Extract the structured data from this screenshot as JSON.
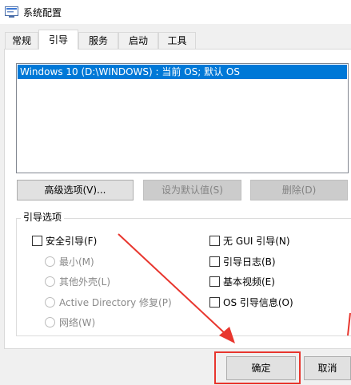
{
  "window": {
    "title": "系统配置",
    "icon": "msconfig-icon"
  },
  "tabs": [
    {
      "label": "常规"
    },
    {
      "label": "引导"
    },
    {
      "label": "服务"
    },
    {
      "label": "启动"
    },
    {
      "label": "工具"
    }
  ],
  "boot_list": {
    "entries": [
      "Windows 10 (D:\\WINDOWS) : 当前 OS; 默认 OS"
    ]
  },
  "buttons": {
    "advanced": "高级选项(V)...",
    "set_default": "设为默认值(S)",
    "delete": "删除(D)",
    "ok": "确定",
    "cancel": "取消"
  },
  "boot_options": {
    "group_label": "引导选项",
    "safe_boot": "安全引导(F)",
    "radios": [
      "最小(M)",
      "其他外壳(L)",
      "Active Directory 修复(P)",
      "网络(W)"
    ],
    "no_gui_boot": "无 GUI 引导(N)",
    "boot_log": "引导日志(B)",
    "base_video": "基本视频(E)",
    "os_boot_info": "OS 引导信息(O)"
  },
  "annotation": {
    "color": "#e8362e"
  }
}
